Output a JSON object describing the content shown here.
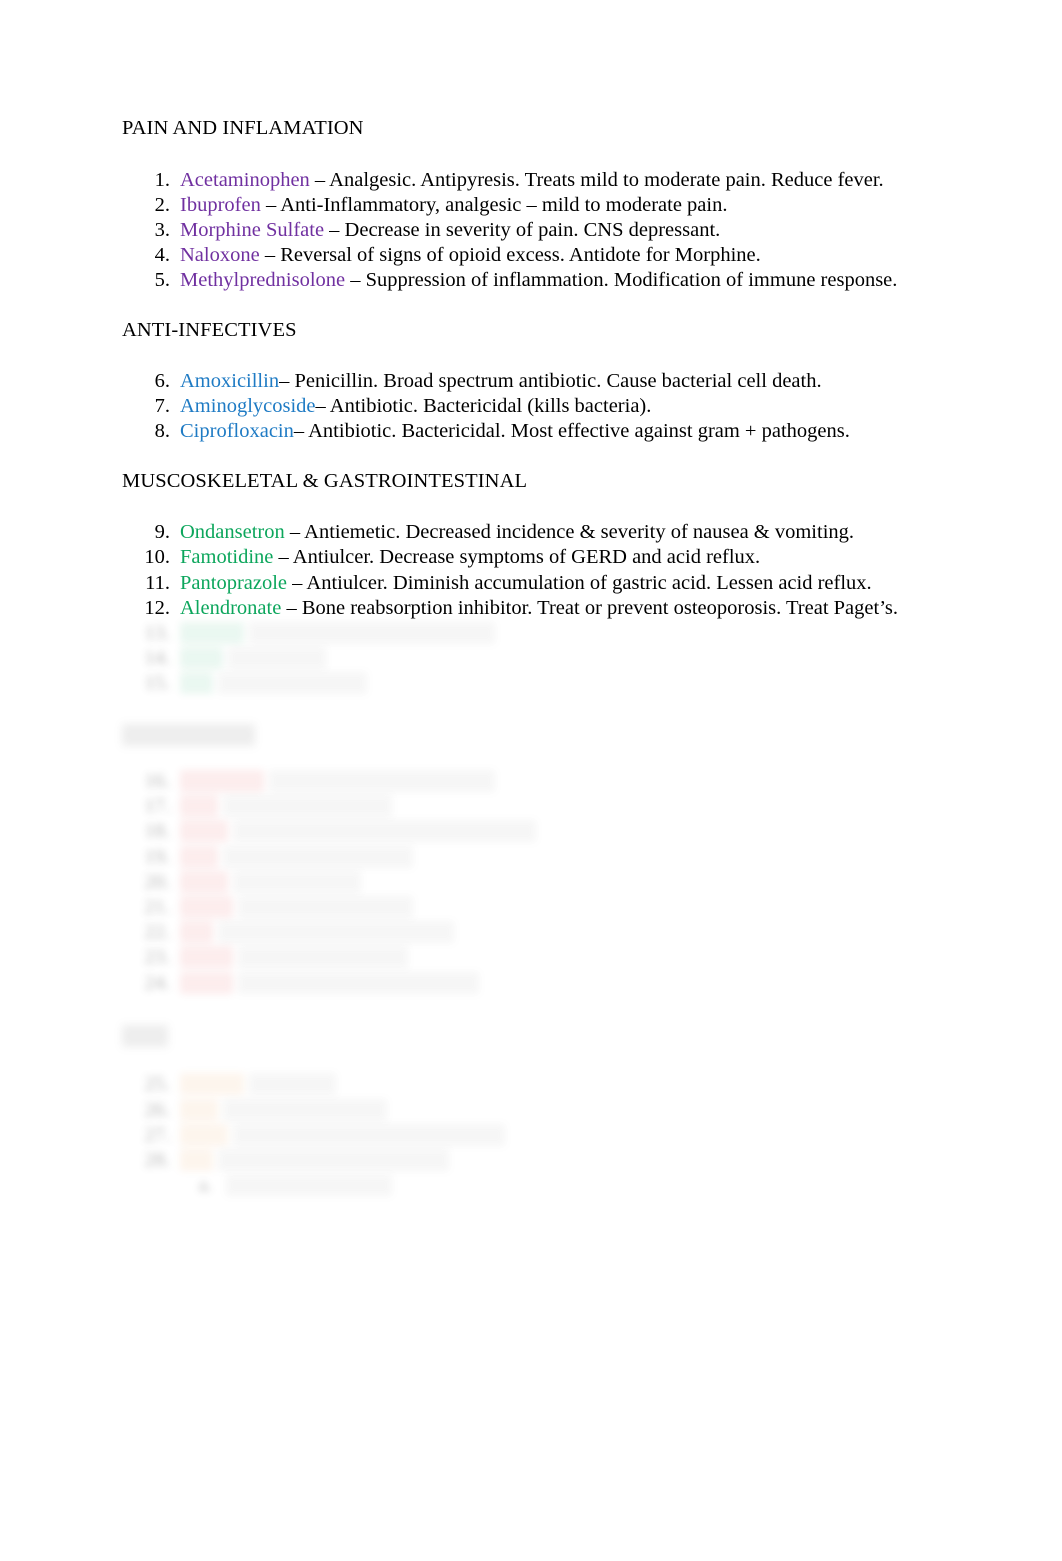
{
  "document": {
    "title": "Pharmacology Drug List Study Guide",
    "page_background": "#ffffff",
    "text_color": "#000000"
  },
  "colors": {
    "pain_and_inflamation": "#7030A0",
    "anti_infectives": "#1F7BC4",
    "musculoskeletal_gastrointestinal": "#0CA65C",
    "redacted_red": "#E8474C",
    "redacted_orange": "#E8913A",
    "heading_black": "#000000"
  },
  "sections": [
    {
      "id": "pain-and-inflamation",
      "heading": "PAIN AND INFLAMATION",
      "name_color": "#7030A0",
      "redacted": false,
      "items": [
        {
          "num": "1.",
          "name": "Acetaminophen",
          "desc": " – Analgesic. Antipyresis. Treats mild to moderate pain. Reduce fever."
        },
        {
          "num": "2.",
          "name": "Ibuprofen",
          "desc": " – Anti-Inflammatory, analgesic – mild to moderate pain."
        },
        {
          "num": "3.",
          "name": "Morphine Sulfate",
          "desc": " – Decrease in severity of pain. CNS depressant."
        },
        {
          "num": "4.",
          "name": "Naloxone",
          "desc": " – Reversal of signs of opioid excess. Antidote for Morphine."
        },
        {
          "num": "5.",
          "name": "Methylprednisolone ",
          "desc": " – Suppression of inflammation. Modification of immune response."
        }
      ]
    },
    {
      "id": "anti-infectives",
      "heading": "ANTI-INFECTIVES",
      "name_color": "#1F7BC4",
      "redacted": false,
      "items": [
        {
          "num": "6.",
          "name": "Amoxicillin",
          "desc": "– Penicillin. Broad spectrum antibiotic. Cause bacterial cell death."
        },
        {
          "num": "7.",
          "name": "Aminoglycoside",
          "desc": "– Antibiotic. Bactericidal (kills bacteria)."
        },
        {
          "num": "8.",
          "name": "Ciprofloxacin",
          "desc": "– Antibiotic. Bactericidal. Most effective against gram + pathogens."
        }
      ]
    },
    {
      "id": "muscoskeletal-gastrointestinal",
      "heading": "MUSCOSKELETAL & GASTROINTESTINAL",
      "name_color": "#0CA65C",
      "redacted": false,
      "items": [
        {
          "num": "9.",
          "name": "Ondansetron ",
          "desc": " – Antiemetic. Decreased incidence & severity of nausea & vomiting."
        },
        {
          "num": "10.",
          "name": "Famotidine",
          "desc": " – Antiulcer. Decrease symptoms of GERD and acid reflux."
        },
        {
          "num": "11.",
          "name": "Pantoprazole ",
          "desc": " – Antiulcer. Diminish accumulation of gastric acid. Lessen acid reflux."
        },
        {
          "num": "12.",
          "name": "Alendronate ",
          "desc": " – Bone reabsorption inhibitor. Treat or prevent osteoporosis. Treat Paget’s."
        }
      ]
    }
  ],
  "redacted_sections": [
    {
      "id": "redacted-green-tail",
      "heading": null,
      "name_color": "#0CA65C",
      "redacted": true,
      "note": "Illegible (blurred) continuation of the green section",
      "items": [
        {
          "num": "13.",
          "name_width": 118,
          "desc_width": 455
        },
        {
          "num": "14.",
          "name_width": 78,
          "desc_width": 180
        },
        {
          "num": "15.",
          "name_width": 62,
          "desc_width": 278
        }
      ]
    },
    {
      "id": "redacted-red-section",
      "heading_width": 248,
      "name_color": "#E8474C",
      "redacted": true,
      "note": "Illegible (blurred) section heading and items",
      "items": [
        {
          "num": "16.",
          "name_width": 158,
          "desc_width": 420
        },
        {
          "num": "17.",
          "name_width": 72,
          "desc_width": 318
        },
        {
          "num": "18.",
          "name_width": 92,
          "desc_width": 570
        },
        {
          "num": "19.",
          "name_width": 74,
          "desc_width": 352
        },
        {
          "num": "20.",
          "name_width": 90,
          "desc_width": 238
        },
        {
          "num": "21.",
          "name_width": 96,
          "desc_width": 320
        },
        {
          "num": "22.",
          "name_width": 58,
          "desc_width": 440
        },
        {
          "num": "23.",
          "name_width": 98,
          "desc_width": 318
        },
        {
          "num": "24.",
          "name_width": 96,
          "desc_width": 450
        }
      ]
    },
    {
      "id": "redacted-orange-section",
      "heading_width": 90,
      "name_color": "#E8913A",
      "redacted": true,
      "note": "Illegible (blurred) section heading and items",
      "items": [
        {
          "num": "25.",
          "name_width": 120,
          "desc_width": 164
        },
        {
          "num": "26.",
          "name_width": 72,
          "desc_width": 310
        },
        {
          "num": "27.",
          "name_width": 92,
          "desc_width": 502
        },
        {
          "num": "28.",
          "name_width": 56,
          "desc_width": 430
        }
      ],
      "sub_items": [
        {
          "num": "a.",
          "desc_width": 322
        }
      ]
    }
  ]
}
